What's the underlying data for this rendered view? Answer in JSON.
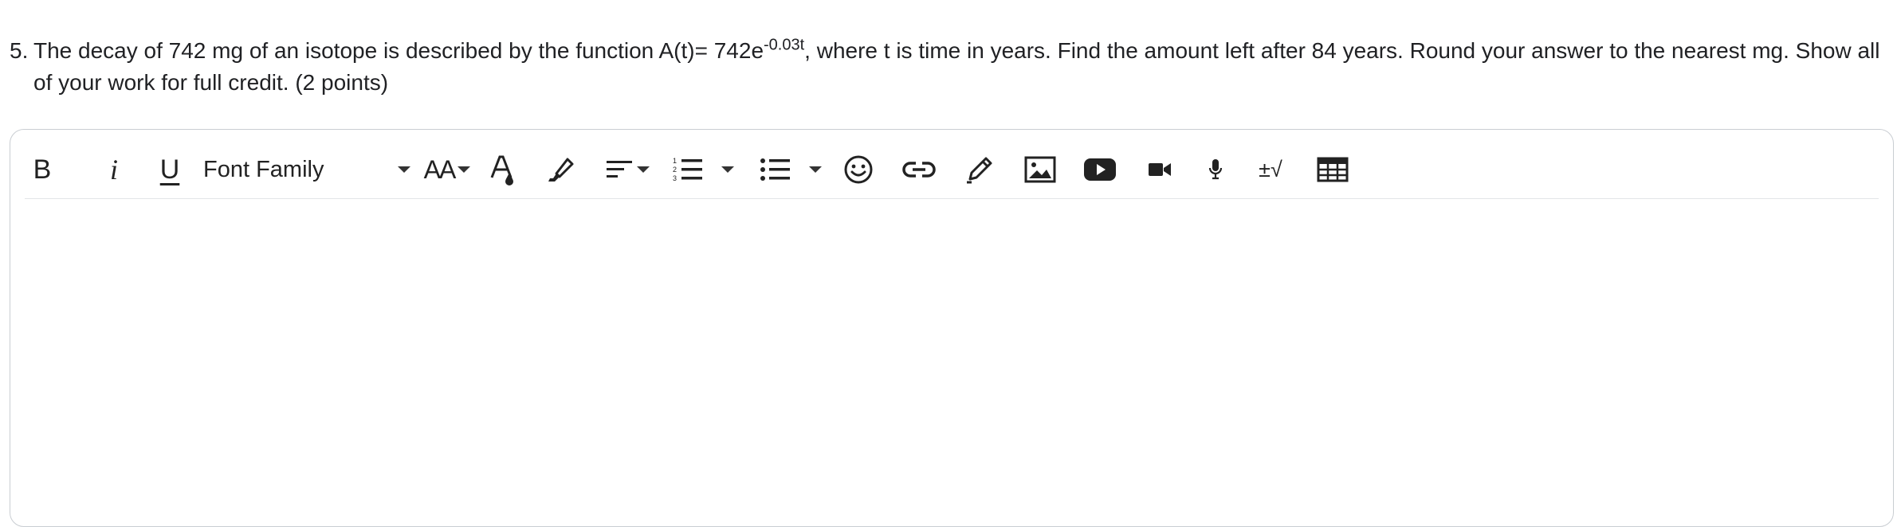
{
  "question": {
    "number": "5.",
    "text_before": "The decay of 742 mg of an isotope is described by the function A(t)= 742e",
    "exponent": "-0.03t",
    "text_after": ", where t is time in years. Find the amount left after 84 years. Round your answer to the nearest mg. Show all of your work for full credit. (2 points)"
  },
  "toolbar": {
    "bold_label": "B",
    "italic_label": "i",
    "underline_label": "U",
    "font_family_label": "Font Family",
    "font_size_label": "AA",
    "math_label": "±√",
    "icons": [
      "bold-icon",
      "italic-icon",
      "underline-icon",
      "font-family-dropdown",
      "font-size-icon",
      "text-color-icon",
      "highlight-icon",
      "align-icon",
      "ordered-list-icon",
      "unordered-list-icon",
      "emoji-icon",
      "link-icon",
      "draw-icon",
      "image-icon",
      "video-icon",
      "video-camera-icon",
      "microphone-icon",
      "math-icon",
      "table-icon"
    ]
  }
}
